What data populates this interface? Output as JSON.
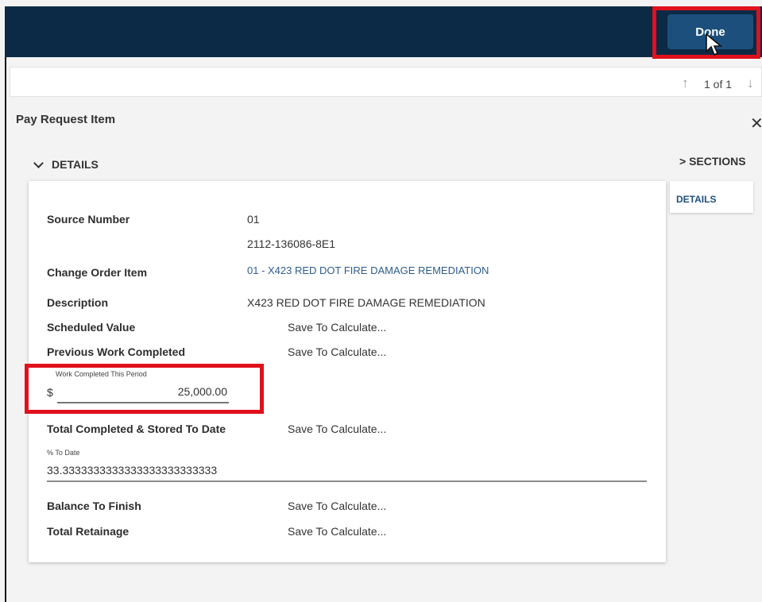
{
  "toolbar": {
    "done_label": "Done"
  },
  "pager": {
    "up_icon": "↑",
    "text": "1 of 1",
    "down_icon": "↓"
  },
  "panel": {
    "title": "Pay Request Item",
    "close_icon": "✕"
  },
  "details": {
    "toggle_label": "DETAILS"
  },
  "sections": {
    "toggle_label": "> SECTIONS",
    "items": [
      "DETAILS"
    ]
  },
  "fields": {
    "source_number": {
      "label": "Source Number",
      "value": "01",
      "secondary": "2112-136086-8E1"
    },
    "change_order_item": {
      "label": "Change Order Item",
      "value": "01 - X423 RED DOT FIRE DAMAGE REMEDIATION"
    },
    "description": {
      "label": "Description",
      "value": "X423 RED DOT FIRE DAMAGE REMEDIATION"
    },
    "scheduled_value": {
      "label": "Scheduled Value",
      "value": "Save To Calculate..."
    },
    "previous_work": {
      "label": "Previous Work Completed",
      "value": "Save To Calculate..."
    },
    "work_completed_period": {
      "label": "Work Completed This Period",
      "currency": "$",
      "value": "25,000.00"
    },
    "total_completed": {
      "label": "Total Completed & Stored To Date",
      "value": "Save To Calculate..."
    },
    "pct_to_date": {
      "label": "% To Date",
      "value": "33.3333333333333333333333333"
    },
    "balance_to_finish": {
      "label": "Balance To Finish",
      "value": "Save To Calculate..."
    },
    "total_retainage": {
      "label": "Total Retainage",
      "value": "Save To Calculate..."
    }
  },
  "colors": {
    "topbar": "#0c2a45",
    "done_button": "#1c4f7c",
    "highlight": "#e0101c",
    "link": "#2e5d8c"
  }
}
